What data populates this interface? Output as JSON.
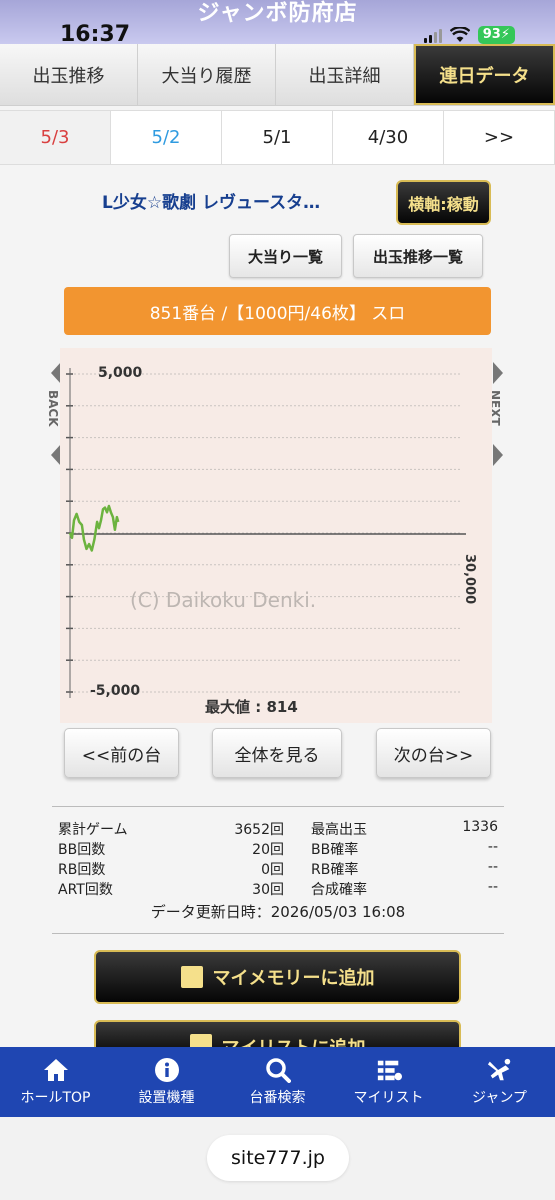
{
  "status": {
    "time": "16:37",
    "battery": "93"
  },
  "site_title": "ジャンボ防府店",
  "tabs": [
    "出玉推移",
    "大当り履歴",
    "出玉詳細",
    "連日データ"
  ],
  "dates": [
    "5/3",
    "5/2",
    "5/1",
    "4/30",
    ">>"
  ],
  "machine": {
    "name": "L少女☆歌劇 レヴュースタ…",
    "axis_button": "横軸:稼動"
  },
  "buttons": {
    "jackpot_list": "大当り一覧",
    "payout_list": "出玉推移一覧"
  },
  "banner": "851番台 /【1000円/46枚】 スロ",
  "graph": {
    "y_top_label": "5,000",
    "y_bottom_label": "-5,000",
    "x_label": "30,000",
    "watermark": "(C) Daikoku Denki.",
    "max_label": "最大値 : 814",
    "back_label": "BACK",
    "next_label": "NEXT"
  },
  "chart_data": {
    "type": "line",
    "ylim": [
      -5000,
      5000
    ],
    "xlim": [
      0,
      30000
    ],
    "x": [
      0,
      150,
      300,
      500,
      700,
      900,
      1050,
      1250,
      1450,
      1650,
      1850,
      2050,
      2200,
      2350,
      2500,
      2650,
      2800,
      2950,
      3100,
      3250,
      3400,
      3550,
      3652
    ],
    "y": [
      0,
      -150,
      400,
      600,
      350,
      250,
      -200,
      -500,
      -350,
      -550,
      -200,
      350,
      150,
      400,
      750,
      800,
      650,
      850,
      650,
      500,
      100,
      500,
      350
    ]
  },
  "nav": {
    "prev": "<<前の台",
    "all": "全体を見る",
    "next": "次の台>>"
  },
  "stats": {
    "rows": [
      {
        "k1": "累計ゲーム",
        "v1": "3652回",
        "k2": "最高出玉",
        "v2": "1336"
      },
      {
        "k1": "BB回数",
        "v1": "20回",
        "k2": "BB確率",
        "v2": "--"
      },
      {
        "k1": "RB回数",
        "v1": "0回",
        "k2": "RB確率",
        "v2": "--"
      },
      {
        "k1": "ART回数",
        "v1": "30回",
        "k2": "合成確率",
        "v2": "--"
      }
    ],
    "updated": "データ更新日時：2026/05/03 16:08"
  },
  "actions": {
    "add_memory": "マイメモリーに追加",
    "add_list": "マイリストに追加"
  },
  "bottom_nav": [
    "ホールTOP",
    "設置機種",
    "台番検索",
    "マイリスト",
    "ジャンプ"
  ],
  "url": "site777.jp"
}
